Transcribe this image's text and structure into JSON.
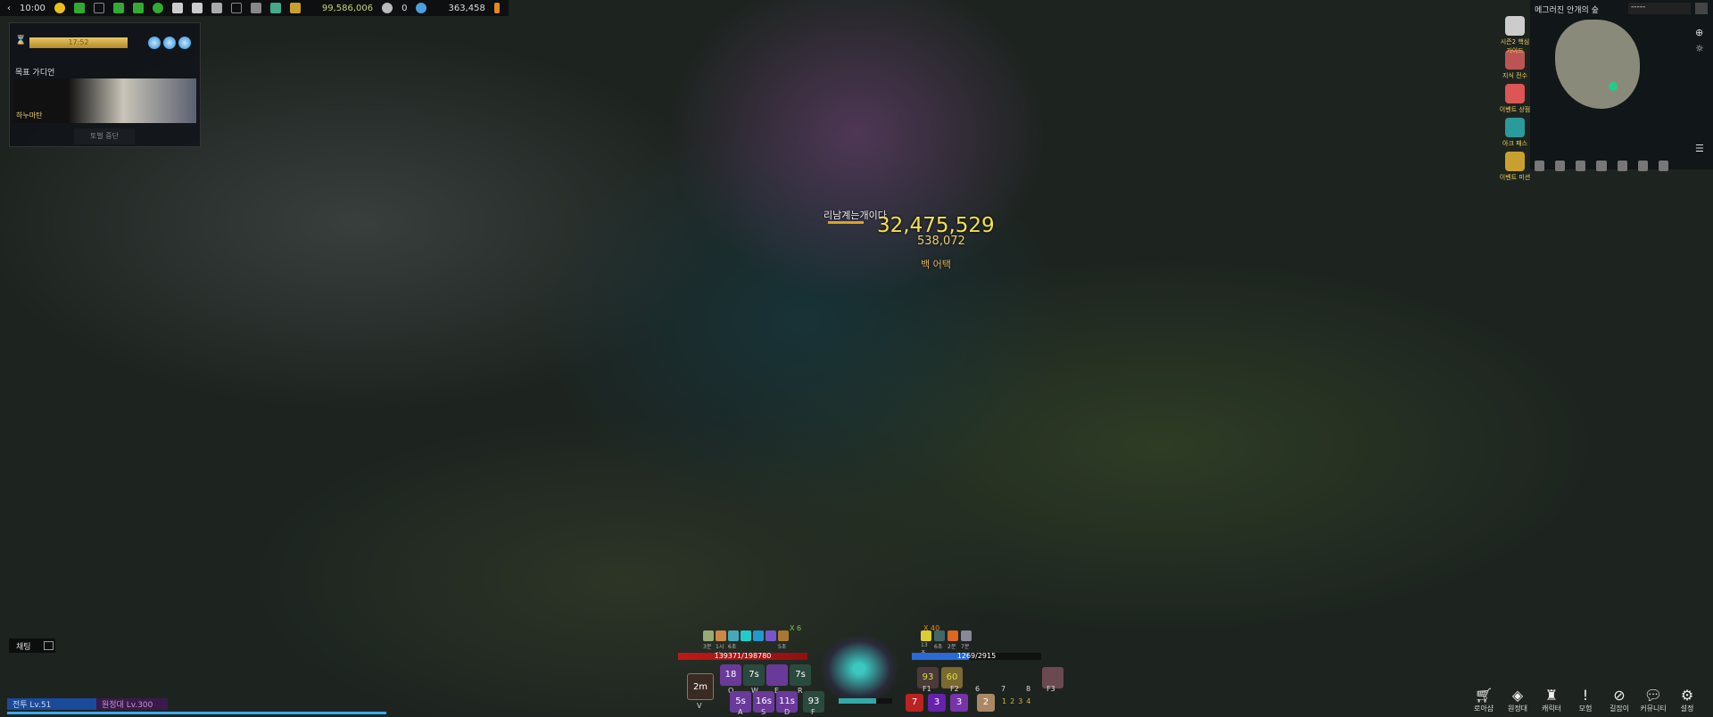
{
  "topbar": {
    "time": "10:00",
    "silver": "99,586,006",
    "crystal": "0",
    "gold": "363,458"
  },
  "guardian": {
    "timer": "17:52",
    "label": "목표 가디언",
    "boss_name": "하누마탄",
    "abandon": "토벌 중단"
  },
  "minimap": {
    "zone": "메그러진 안개의 숲",
    "channel": "-----"
  },
  "side_menu": [
    {
      "label": "시즌2 핵심가이드"
    },
    {
      "label": "지식 전수"
    },
    {
      "label": "이벤트 상점"
    },
    {
      "label": "아크 패스"
    },
    {
      "label": "이벤트 미션"
    }
  ],
  "combat": {
    "player_name": "리남계는개이다",
    "damage": "32,475,529",
    "damage2": "538,072",
    "back_attack": "백 어택"
  },
  "hud": {
    "buff_stack": "X 6",
    "debuff_stack": "X 40",
    "buff_timers": [
      "3분",
      "1시간",
      "6초",
      "",
      "",
      "",
      "5초"
    ],
    "debuff_timers": [
      "13초",
      "6초",
      "2분",
      "7분"
    ],
    "hp": "139371/198780",
    "mp": "1269/2915",
    "skills": [
      {
        "key": "Q",
        "cd": "18"
      },
      {
        "key": "W",
        "cd": "7s"
      },
      {
        "key": "E",
        "cd": ""
      },
      {
        "key": "R",
        "cd": "7s"
      },
      {
        "key": "A",
        "cd": "5s"
      },
      {
        "key": "S",
        "cd": "16s"
      },
      {
        "key": "D",
        "cd": "11s"
      },
      {
        "key": "F",
        "cd": "93"
      }
    ],
    "awakening": {
      "key": "V",
      "cd": "2m"
    },
    "items": [
      {
        "key": "F1",
        "cd": "93"
      },
      {
        "key": "F2",
        "cd": "60"
      },
      {
        "key": "6"
      },
      {
        "key": "7"
      },
      {
        "key": "8"
      },
      {
        "key": "F3"
      }
    ],
    "consumables": [
      {
        "key": "1",
        "count": "7"
      },
      {
        "key": "2",
        "count": "3"
      },
      {
        "key": "3",
        "count": "3"
      },
      {
        "key": "",
        "count": "2"
      }
    ],
    "slots": [
      "1",
      "2",
      "3",
      "4"
    ]
  },
  "chat": {
    "label": "채팅"
  },
  "levels": {
    "combat": "전투 Lv.51",
    "expedition": "원정대 Lv.300"
  },
  "bottom_menu": [
    "로아샵",
    "원정대",
    "캐릭터",
    "모험",
    "길잡이",
    "커뮤니티",
    "설정"
  ]
}
